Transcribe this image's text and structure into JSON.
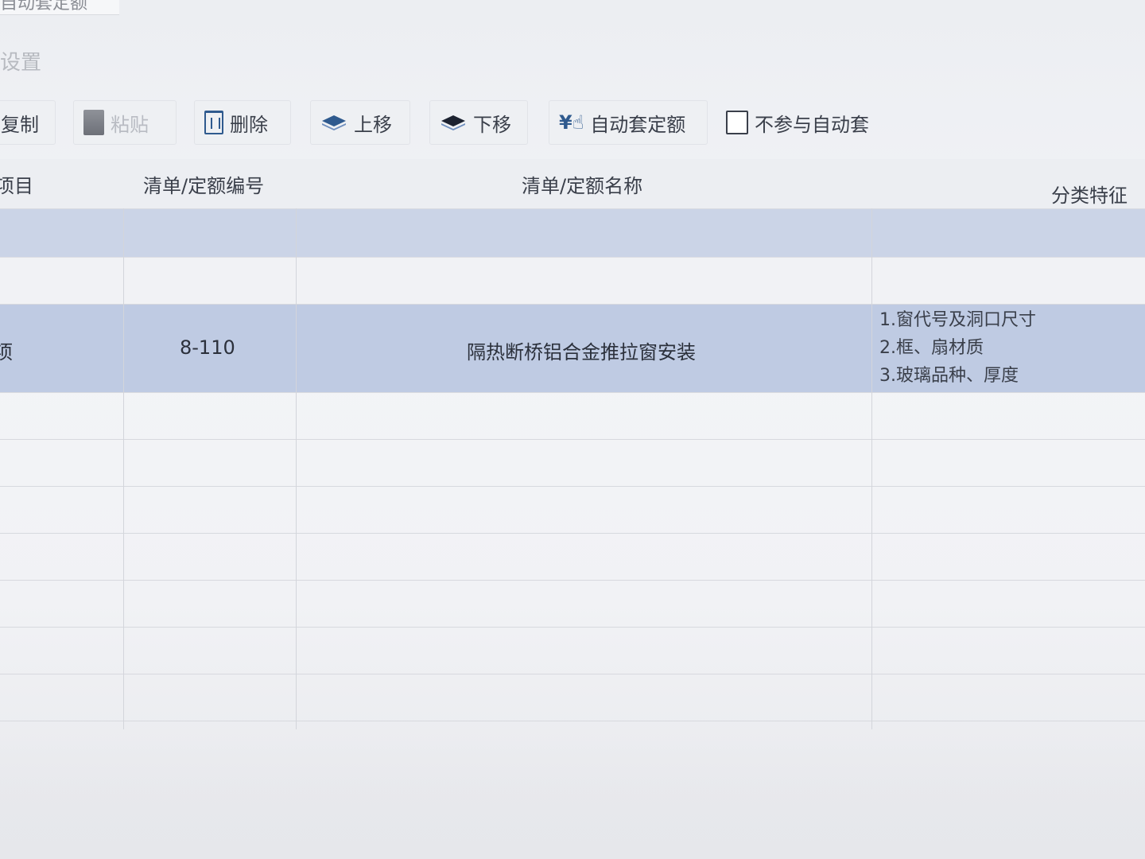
{
  "window": {
    "title": "自动套定额",
    "section": "设置"
  },
  "toolbar": {
    "copy_label": "复制",
    "paste_label": "粘贴",
    "delete_label": "删除",
    "move_up_label": "上移",
    "move_down_label": "下移",
    "auto_quota_label": "自动套定额",
    "exclude_label": "不参与自动套",
    "exclude_checked": false
  },
  "table": {
    "headers": {
      "item": "项目",
      "code": "清单/定额编号",
      "name": "清单/定额名称",
      "feature": "分类特征"
    },
    "selected_row": {
      "item": "项",
      "code": "8-110",
      "name": "隔热断桥铝合金推拉窗安装",
      "features": [
        "1.窗代号及洞口尺寸",
        "2.框、扇材质",
        "3.玻璃品种、厚度"
      ]
    }
  },
  "colors": {
    "selected_row": "#bfcbe3",
    "icon_blue": "#2f5a8e"
  }
}
